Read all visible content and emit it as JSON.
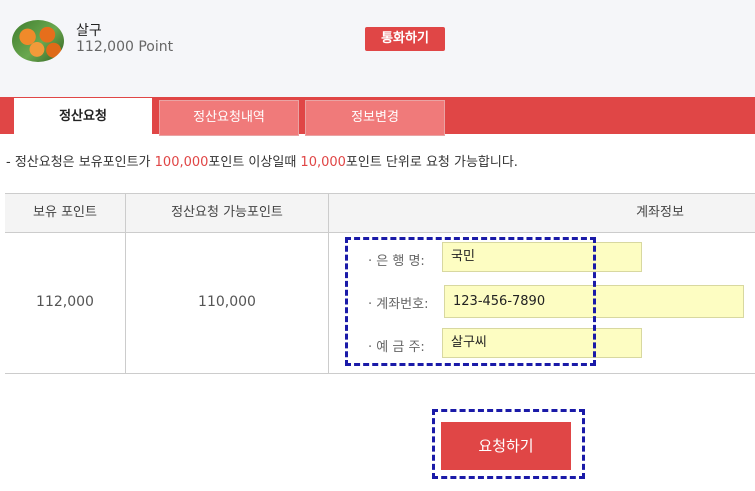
{
  "header": {
    "user_name": "살구",
    "points": "112,000 Point",
    "call_button": "통화하기"
  },
  "tabs": [
    {
      "label": "정산요청",
      "active": true
    },
    {
      "label": "정산요청내역",
      "active": false
    },
    {
      "label": "정보변경",
      "active": false
    }
  ],
  "notice": {
    "prefix": "- 정산요청은 보유포인트가 ",
    "amount1": "100,000",
    "middle": "포인트 이상일때 ",
    "amount2": "10,000",
    "suffix": "포인트 단위로 요청 가능합니다."
  },
  "table": {
    "headers": [
      "보유 포인트",
      "정산요청 가능포인트",
      "계좌정보"
    ],
    "held_points": "112,000",
    "available_points": "110,000"
  },
  "account": {
    "bank_label": "· 은 행 명:",
    "bank_value": "국민",
    "account_label": "· 계좌번호:",
    "account_value": "123-456-7890",
    "holder_label": "· 예 금 주:",
    "holder_value": "살구씨"
  },
  "submit_button": "요청하기",
  "colors": {
    "accent": "#e04646",
    "tab_inactive": "#f07a7a",
    "input_bg": "#fdfdc2",
    "highlight_box": "#1a1aa8"
  }
}
